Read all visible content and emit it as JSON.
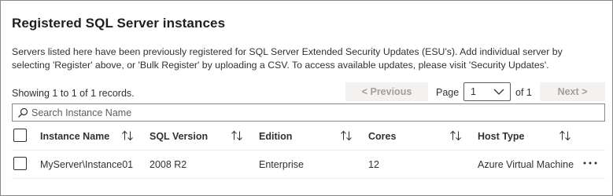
{
  "panel": {
    "title": "Registered SQL Server instances",
    "description": "Servers listed here have been previously registered for SQL Server Extended Security Updates (ESU's). Add individual server by selecting 'Register' above, or 'Bulk Register' by uploading a CSV. To access available updates, please visit 'Security Updates'."
  },
  "pagination": {
    "showing_text": "Showing 1 to 1 of 1 records.",
    "previous_label": "< Previous",
    "page_label": "Page",
    "page_value": "1",
    "of_label": "of 1",
    "next_label": "Next >"
  },
  "search": {
    "placeholder": "Search Instance Name",
    "value": ""
  },
  "table": {
    "columns": [
      "Instance Name",
      "SQL Version",
      "Edition",
      "Cores",
      "Host Type"
    ],
    "rows": [
      {
        "instance_name": "MyServer\\Instance01",
        "sql_version": "2008 R2",
        "edition": "Enterprise",
        "cores": "12",
        "host_type": "Azure Virtual Machine"
      }
    ]
  },
  "icons": {
    "search": "search-icon",
    "sort": "sort-icon",
    "chevron": "chevron-down-icon",
    "more": "more-options-icon"
  },
  "colors": {
    "disabled_button_bg": "#f3f2f1",
    "disabled_button_text": "#a19f9d",
    "border": "#8a8886",
    "text": "#323130"
  }
}
